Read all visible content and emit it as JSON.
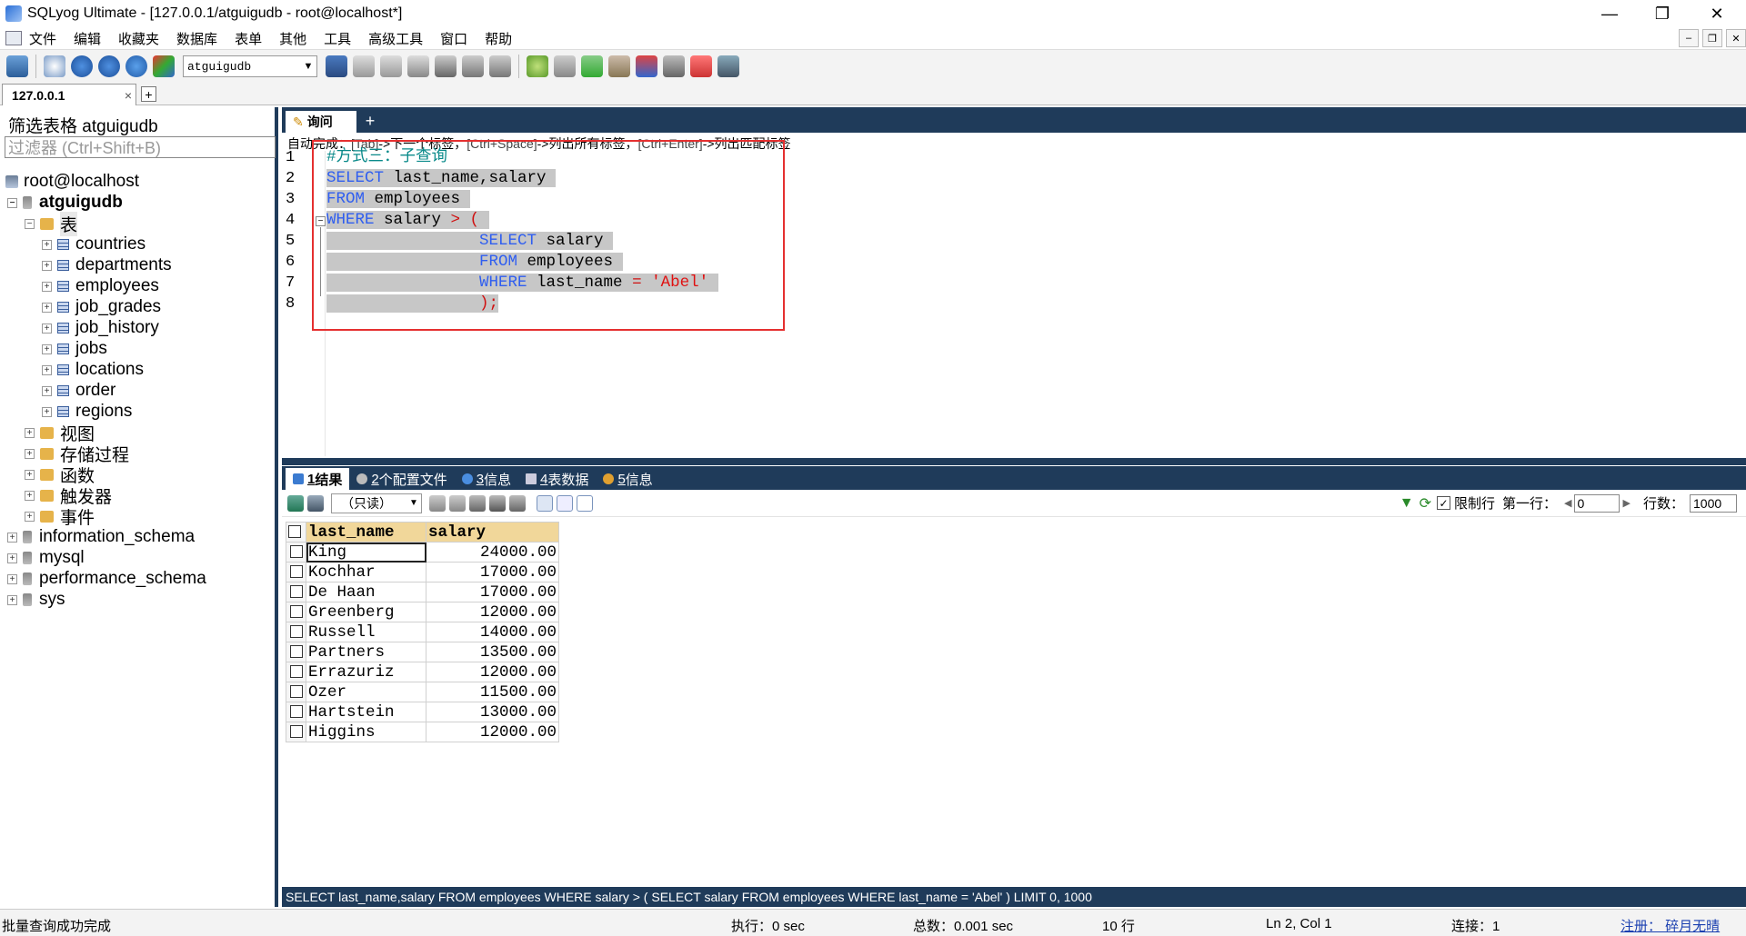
{
  "window": {
    "title": "SQLyog Ultimate - [127.0.0.1/atguigudb - root@localhost*]"
  },
  "menu": [
    "文件",
    "编辑",
    "收藏夹",
    "数据库",
    "表单",
    "其他",
    "工具",
    "高级工具",
    "窗口",
    "帮助"
  ],
  "toolbar": {
    "db_select": "atguigudb"
  },
  "connection_tab": {
    "label": "127.0.0.1",
    "close": "×",
    "add": "+"
  },
  "object_browser": {
    "filter_label": "筛选表格 atguigudb",
    "filter_placeholder": "过滤器 (Ctrl+Shift+B)",
    "server": "root@localhost",
    "database": "atguigudb",
    "tables_folder": "表",
    "tables": [
      "countries",
      "departments",
      "employees",
      "job_grades",
      "job_history",
      "jobs",
      "locations",
      "order",
      "regions"
    ],
    "folders": [
      "视图",
      "存储过程",
      "函数",
      "触发器",
      "事件"
    ],
    "other_databases": [
      "information_schema",
      "mysql",
      "performance_schema",
      "sys"
    ]
  },
  "query_tab": {
    "label": "询问",
    "add": "+"
  },
  "hint": {
    "p1": "自动完成：",
    "k1": "[Tab]",
    "p2": "->下一个标签，",
    "k2": "[Ctrl+Space]",
    "p3": "->列出所有标签，",
    "k3": "[Ctrl+Enter]",
    "p4": "->列出匹配标签"
  },
  "editor": {
    "line_numbers": [
      "1",
      "2",
      "3",
      "4",
      "5",
      "6",
      "7",
      "8"
    ],
    "l1": "#方式三：子查询",
    "l2_kw": "SELECT",
    "l2_rest": " last_name,salary ",
    "l3_kw": "FROM",
    "l3_rest": " employees ",
    "l4_kw": "WHERE",
    "l4_rest": " salary ",
    "l4_op": "> (",
    "l5_kw": "SELECT",
    "l5_rest": " salary ",
    "l6_kw": "FROM",
    "l6_rest": " employees ",
    "l7_kw": "WHERE",
    "l7_rest": " last_name ",
    "l7_op": "=",
    "l7_str": "'Abel'",
    "l8_op": ");"
  },
  "result_tabs": [
    {
      "num": "1",
      "label": " 结果"
    },
    {
      "num": "2",
      "label": " 个配置文件"
    },
    {
      "num": "3",
      "label": " 信息"
    },
    {
      "num": "4",
      "label": " 表数据"
    },
    {
      "num": "5",
      "label": " 信息"
    }
  ],
  "result_toolbar": {
    "mode": "（只读）",
    "limit_label": "限制行",
    "first_row_label": "第一行：",
    "first_row": "0",
    "rows_label": "行数：",
    "rows": "1000"
  },
  "grid": {
    "columns": [
      "last_name",
      "salary"
    ],
    "rows": [
      [
        "King",
        "24000.00"
      ],
      [
        "Kochhar",
        "17000.00"
      ],
      [
        "De Haan",
        "17000.00"
      ],
      [
        "Greenberg",
        "12000.00"
      ],
      [
        "Russell",
        "14000.00"
      ],
      [
        "Partners",
        "13500.00"
      ],
      [
        "Errazuriz",
        "12000.00"
      ],
      [
        "Ozer",
        "11500.00"
      ],
      [
        "Hartstein",
        "13000.00"
      ],
      [
        "Higgins",
        "12000.00"
      ]
    ]
  },
  "executed_sql": "SELECT last_name,salary FROM employees WHERE salary > ( SELECT salary FROM employees WHERE last_name = 'Abel' ) LIMIT 0, 1000",
  "status": {
    "message": "批量查询成功完成",
    "exec": "执行：0 sec",
    "total": "总数：0.001 sec",
    "rows": "10 行",
    "position": "Ln 2, Col 1",
    "connections": "连接：1",
    "register": "注册： 碎月无晴"
  },
  "colors": {
    "accent_dark": "#1f3b5a",
    "selection_box": "#e53030",
    "keyword": "#2f5ef0",
    "string": "#e01010",
    "comment": "#0a8a8a",
    "header": "#f1d79a"
  }
}
